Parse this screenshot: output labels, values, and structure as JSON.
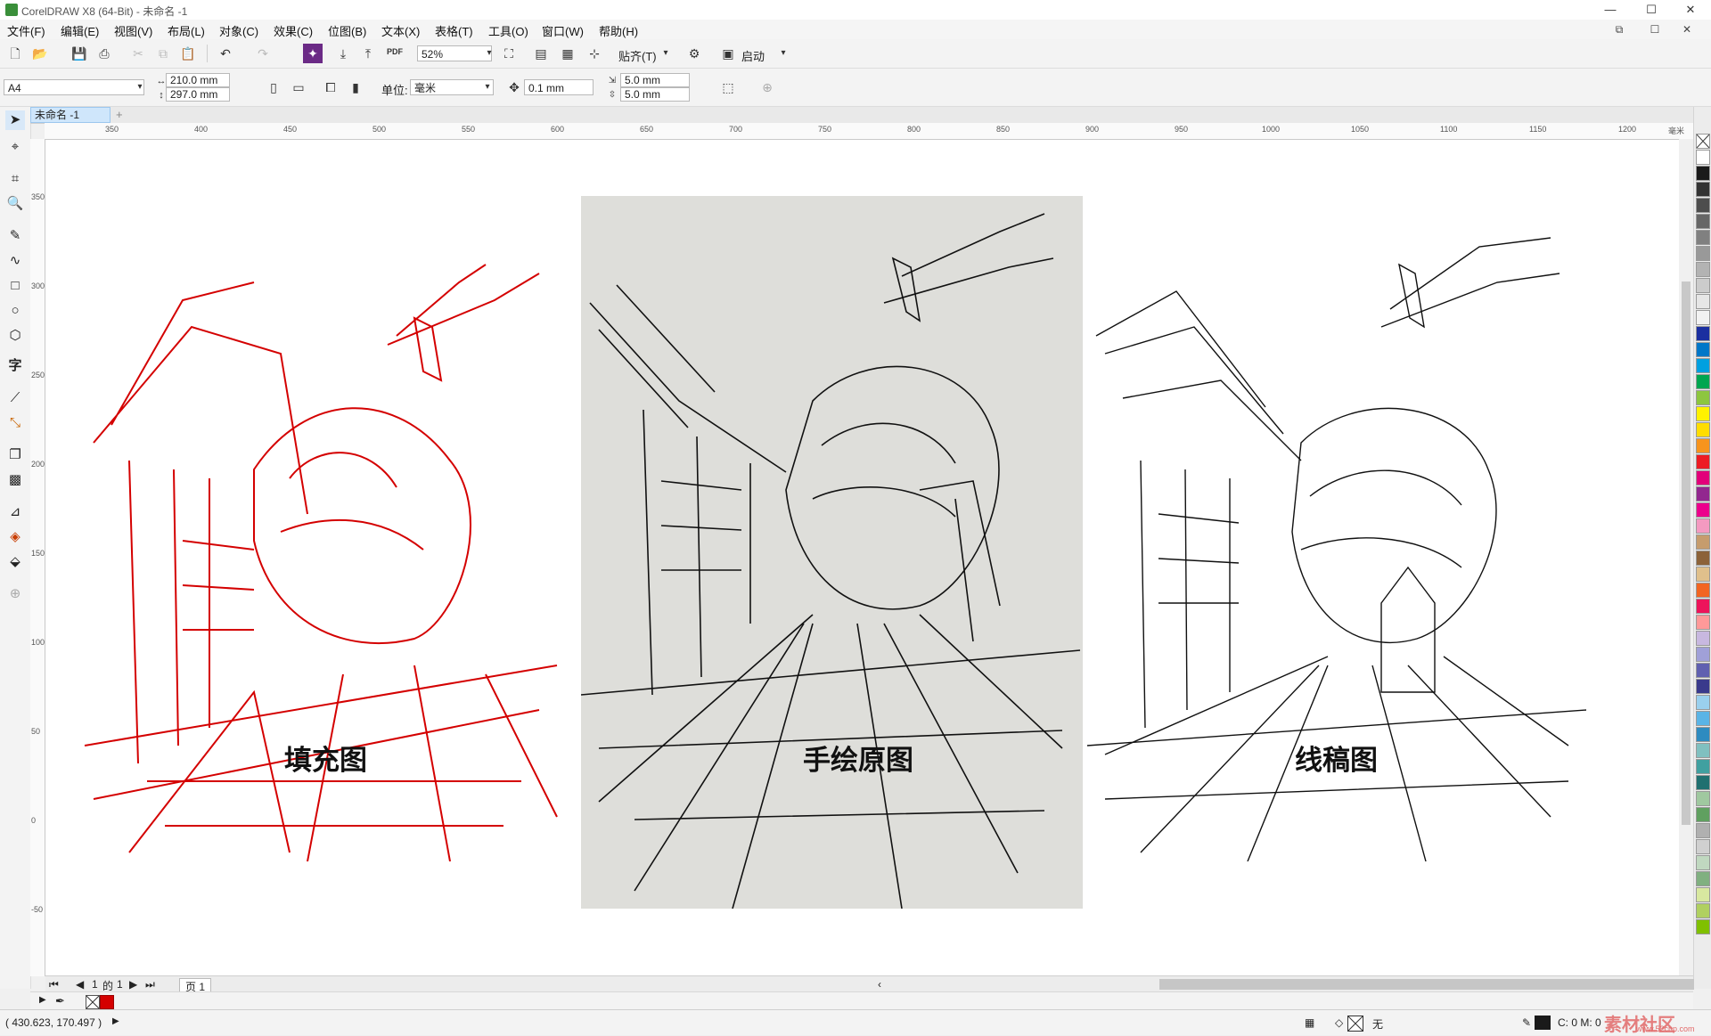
{
  "window": {
    "title": "CorelDRAW X8 (64-Bit) - 未命名 -1",
    "controls": {
      "restore_sub": "⧉",
      "minimize": "—",
      "maximize": "☐",
      "close": "✕"
    }
  },
  "menu": {
    "items": [
      "文件(F)",
      "编辑(E)",
      "视图(V)",
      "布局(L)",
      "对象(C)",
      "效果(C)",
      "位图(B)",
      "文本(X)",
      "表格(T)",
      "工具(O)",
      "窗口(W)",
      "帮助(H)"
    ]
  },
  "standard_toolbar": {
    "zoom_value": "52%",
    "snap_label": "贴齐(T)",
    "launch_label": "启动",
    "pdf_label": "PDF"
  },
  "property_bar": {
    "page_size": "A4",
    "width": "210.0 mm",
    "height": "297.0 mm",
    "units_label": "单位:",
    "units_value": "毫米",
    "nudge": "0.1 mm",
    "dup_x": "5.0 mm",
    "dup_y": "5.0 mm"
  },
  "document": {
    "tab_label": "未命名 -1",
    "add_tab": "+"
  },
  "ruler": {
    "h_ticks": [
      "350",
      "400",
      "450",
      "500",
      "550",
      "600",
      "650",
      "700",
      "750",
      "800",
      "850",
      "900",
      "950",
      "1000",
      "1050",
      "1100",
      "1150",
      "1200"
    ],
    "h_unit": "毫米",
    "v_ticks": [
      "350",
      "300",
      "250",
      "200",
      "150",
      "100",
      "50",
      "0",
      "-50"
    ]
  },
  "canvas": {
    "captions": {
      "left": "填充图",
      "center": "手绘原图",
      "right": "线稿图"
    }
  },
  "page_nav": {
    "current": "1",
    "of_label": "的",
    "total": "1",
    "page_tab": "页 1"
  },
  "status": {
    "coordinates": "( 430.623, 170.497 )",
    "fill_label": "无",
    "color_info": "C: 0 M: 0"
  },
  "watermark": {
    "text": "素材社区",
    "url": "www.52cnp.com"
  },
  "colors": {
    "accent_red": "#d40000",
    "tab_blue": "#cfe6fb"
  },
  "palette": [
    "#ffffff",
    "#1a1a1a",
    "#333333",
    "#4d4d4d",
    "#666666",
    "#808080",
    "#999999",
    "#b3b3b3",
    "#cccccc",
    "#e6e6e6",
    "#f2f2f2",
    "#1b2fa0",
    "#0077c8",
    "#00a0e0",
    "#00a650",
    "#8dc63f",
    "#fff200",
    "#ffdd00",
    "#f7941d",
    "#ed1c24",
    "#e2007a",
    "#92278f",
    "#ec008c",
    "#f49ac1",
    "#c69c6d",
    "#8c6239",
    "#e0c08c",
    "#f26522",
    "#ed145b",
    "#ff9999",
    "#c8b8e0",
    "#a0a0d8",
    "#6060b0",
    "#3a3a8c",
    "#9ad0ee",
    "#5ab4e6",
    "#2e8bc0",
    "#80c0c0",
    "#40a0a0",
    "#207070",
    "#a0c8a0",
    "#60a060",
    "#b0b0b0",
    "#d0d0d0",
    "#c0d8c0",
    "#80b080",
    "#d8e8a0",
    "#b0d060",
    "#80c000"
  ]
}
